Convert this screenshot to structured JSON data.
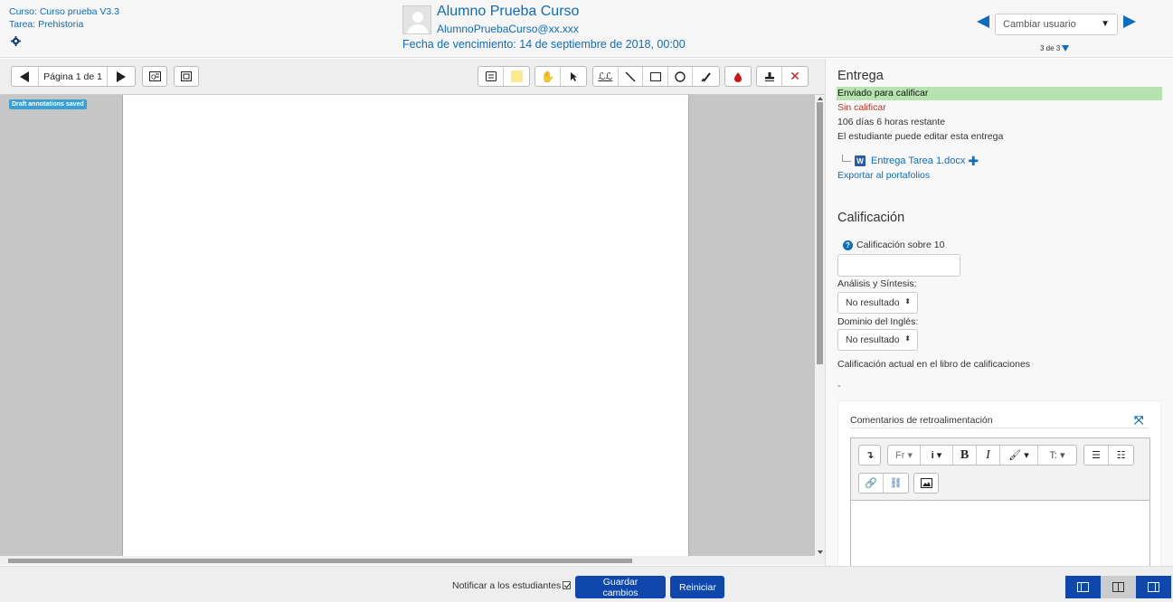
{
  "header": {
    "course": "Curso: Curso prueba V3.3",
    "assignment": "Tarea: Prehistoria",
    "student_name": "Alumno Prueba Curso",
    "student_email": "AlumnoPruebaCurso@xx.xxx",
    "due_date": "Fecha de vencimiento: 14 de septiembre de 2018, 00:00",
    "change_user_placeholder": "Cambiar usuario",
    "user_count": "3 de 3"
  },
  "pdf_toolbar": {
    "page_label": "Página 1 de 1"
  },
  "pdf_area": {
    "draft_badge": "Draft annotations saved"
  },
  "submission": {
    "title": "Entrega",
    "status": "Enviado para calificar",
    "grading_status": "Sin calificar",
    "time_remaining": "106 días 6 horas restante",
    "editable_note": "El estudiante puede editar esta entrega",
    "file_name": "Entrega Tarea 1.docx",
    "export_link": "Exportar al portafolios"
  },
  "grade": {
    "title": "Calificación",
    "grade_label": "Calificación sobre 10",
    "grade_value": "",
    "outcome1_label": "Análisis y Síntesis:",
    "outcome1_value": "No resultado",
    "outcome2_label": "Dominio del Inglés:",
    "outcome2_value": "No resultado",
    "current_grade_label": "Calificación actual en el libro de calificaciones",
    "current_grade_value": "-"
  },
  "feedback": {
    "title": "Comentarios de retroalimentación"
  },
  "footer": {
    "notify_label": "Notificar a los estudiantes",
    "save_button": "Guardar cambios",
    "reset_button": "Reiniciar"
  },
  "colors": {
    "accent": "#0f6cbf",
    "primary_button": "#0f47ad",
    "status_green": "#b7e3b0",
    "status_red": "#ca3120"
  }
}
